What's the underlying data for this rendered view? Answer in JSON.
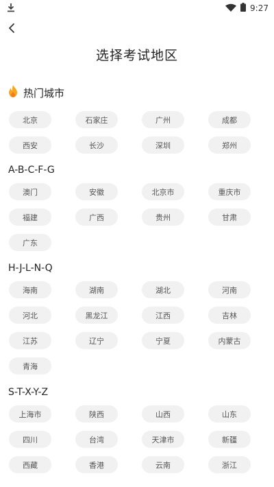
{
  "status_bar": {
    "time": "9:27"
  },
  "header": {
    "title": "选择考试地区"
  },
  "hot": {
    "title": "热门城市",
    "cities": [
      "北京",
      "石家庄",
      "广州",
      "成都",
      "西安",
      "长沙",
      "深圳",
      "郑州"
    ]
  },
  "groups": [
    {
      "title": "A-B-C-F-G",
      "items": [
        "澳门",
        "安徽",
        "北京市",
        "重庆市",
        "福建",
        "广西",
        "贵州",
        "甘肃",
        "广东"
      ]
    },
    {
      "title": "H-J-L-N-Q",
      "items": [
        "海南",
        "湖南",
        "湖北",
        "河南",
        "河北",
        "黑龙江",
        "江西",
        "吉林",
        "江苏",
        "辽宁",
        "宁夏",
        "内蒙古",
        "青海"
      ]
    },
    {
      "title": "S-T-X-Y-Z",
      "items": [
        "上海市",
        "陕西",
        "山西",
        "山东",
        "四川",
        "台湾",
        "天津市",
        "新疆",
        "西藏",
        "香港",
        "云南",
        "浙江"
      ]
    }
  ],
  "icons": {
    "download": "download-icon",
    "wifi": "wifi-icon",
    "back": "back-arrow-icon",
    "hot": "flame-icon"
  },
  "colors": {
    "chip_bg": "#f1f1f1",
    "chip_text": "#555555",
    "flame": "#f5a623"
  }
}
